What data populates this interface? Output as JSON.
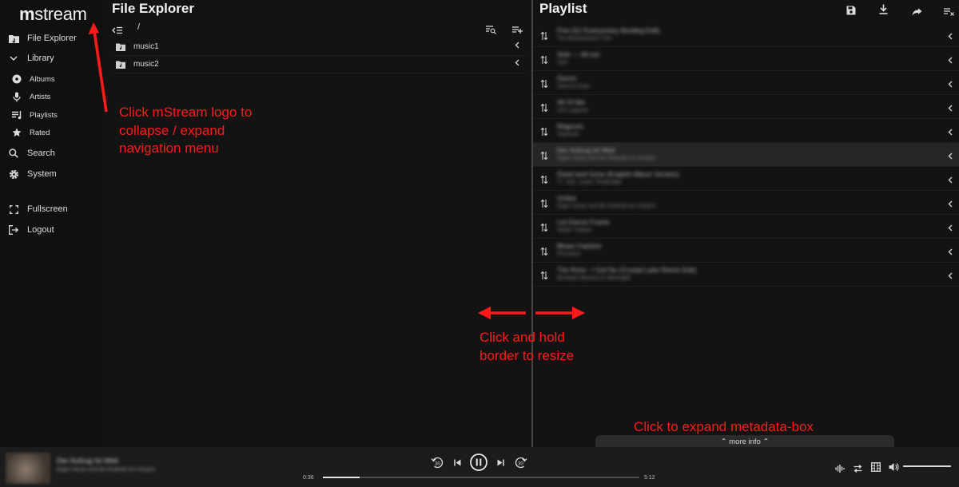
{
  "app": {
    "logo_m": "m",
    "logo_rest": "stream"
  },
  "sidebar": {
    "items": [
      {
        "label": "File Explorer"
      },
      {
        "label": "Library"
      },
      {
        "label": "Albums"
      },
      {
        "label": "Artists"
      },
      {
        "label": "Playlists"
      },
      {
        "label": "Rated"
      },
      {
        "label": "Search"
      },
      {
        "label": "System"
      },
      {
        "label": "Fullscreen"
      },
      {
        "label": "Logout"
      }
    ]
  },
  "file_explorer": {
    "title": "File Explorer",
    "path": "/",
    "folders": [
      {
        "name": "music1"
      },
      {
        "name": "music2"
      }
    ]
  },
  "playlist": {
    "title": "Playlist",
    "songs": [
      {
        "title": "Five 0(1 Everyonesy Bootleg Edit)",
        "artist": "The Bnmuntstors Trim"
      },
      {
        "title": "Sink — All out",
        "artist": "Sink"
      },
      {
        "title": "Denim",
        "artist": "Dainrut Hoan"
      },
      {
        "title": "All Of Me",
        "artist": "Unk Laguine"
      },
      {
        "title": "Magnum",
        "artist": "Sadmoth"
      },
      {
        "title": "Der Aufzug Ist Weit",
        "artist": "Eigen Nivas and Be Rednalt em Herjem"
      },
      {
        "title": "Dead and Gone (English Album Version)",
        "artist": "T.I. feat. Justin Timberlake"
      },
      {
        "title": "Unties",
        "artist": "Eigen Nivas and Be Rednalt em Herjem"
      },
      {
        "title": "Let Dance Frame",
        "artist": "Walsh Tubard"
      },
      {
        "title": "Blown Fashion",
        "artist": "Phonteen"
      },
      {
        "title": "The Rock - I Got No (Crystal Lake Remix Edit)",
        "artist": "Brooklyn Bounce & Silverlight"
      }
    ]
  },
  "annotations": {
    "logo_line1": "Click mStream logo to",
    "logo_line2": "collapse / expand",
    "logo_line3": "navigation menu",
    "resize_line1": "Click and hold",
    "resize_line2": "border to resize",
    "metadata": "Click to expand metadata-box"
  },
  "more_info": {
    "label": "more info"
  },
  "player": {
    "now_playing_title": "Der Aufzug Ist Weit",
    "now_playing_artist": "Eigen Nivas and Be Rednalt em Herjem",
    "current_time": "0:36",
    "duration": "5:12",
    "progress": 0.115,
    "volume": 1.0,
    "skip_back_seconds": "30",
    "skip_forward_seconds": "30"
  },
  "colors": {
    "accent_annotation": "#ff1a1a",
    "background": "#131313",
    "player_bg": "#1c1c1c"
  }
}
